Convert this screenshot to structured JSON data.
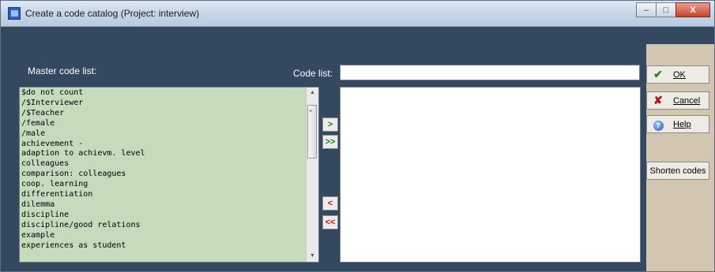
{
  "window": {
    "title": "Create a code catalog (Project: interview)",
    "controls": {
      "minimize": "–",
      "maximize": "□",
      "close": "X"
    }
  },
  "labels": {
    "master": "Master code list:",
    "code_list": "Code list:"
  },
  "master_codes": [
    "$do not count",
    "/$Interviewer",
    "/$Teacher",
    "/female",
    "/male",
    "achievement -",
    "adaption to achievm. level",
    "colleagues",
    "comparison: colleagues",
    "coop. learning",
    "differentiation",
    "dilemma",
    "discipline",
    "discipline/good relations",
    "example",
    "experiences as student"
  ],
  "code_list_value": "",
  "transfer_buttons": {
    "add_one": ">",
    "add_all": ">>",
    "remove_one": "<",
    "remove_all": "<<"
  },
  "buttons": {
    "ok": "OK",
    "cancel": "Cancel",
    "help": "Help",
    "shorten": "Shorten codes"
  },
  "icons": {
    "ok": "check-icon",
    "cancel": "x-icon",
    "help": "help-icon"
  },
  "colors": {
    "background": "#34495f",
    "master_list_bg": "#c4dcbc",
    "side_panel": "#d2c6b0",
    "arrow_green": "#0a8a0a",
    "arrow_red": "#d01010"
  }
}
